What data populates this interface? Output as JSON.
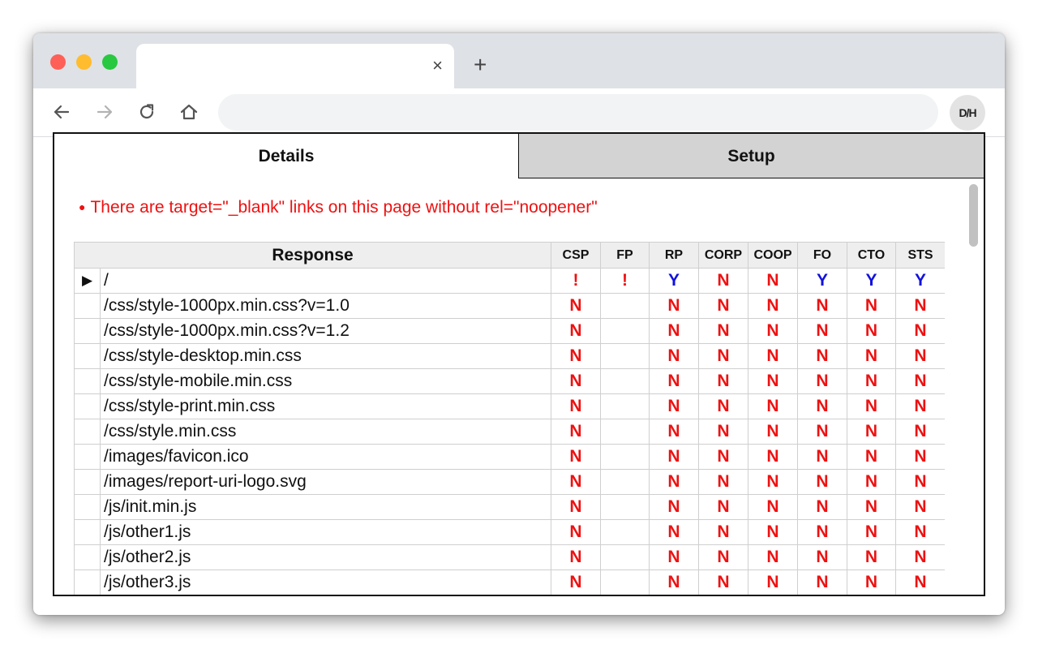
{
  "browser": {
    "tab_title": "",
    "tab_close": "×",
    "new_tab": "+",
    "address_value": "",
    "extension_label": "D/H"
  },
  "popup": {
    "tabs": [
      {
        "label": "Details",
        "active": true
      },
      {
        "label": "Setup",
        "active": false
      }
    ],
    "warning": "There are target=\"_blank\" links on this page without rel=\"noopener\"",
    "table": {
      "headers": [
        "Response",
        "CSP",
        "FP",
        "RP",
        "CORP",
        "COOP",
        "FO",
        "CTO",
        "STS"
      ],
      "rows": [
        {
          "marker": "▶",
          "url": "/",
          "values": [
            "!",
            "!",
            "Y",
            "N",
            "N",
            "Y",
            "Y",
            "Y"
          ]
        },
        {
          "marker": "",
          "url": "/css/style-1000px.min.css?v=1.0",
          "values": [
            "N",
            "",
            "N",
            "N",
            "N",
            "N",
            "N",
            "N"
          ]
        },
        {
          "marker": "",
          "url": "/css/style-1000px.min.css?v=1.2",
          "values": [
            "N",
            "",
            "N",
            "N",
            "N",
            "N",
            "N",
            "N"
          ]
        },
        {
          "marker": "",
          "url": "/css/style-desktop.min.css",
          "values": [
            "N",
            "",
            "N",
            "N",
            "N",
            "N",
            "N",
            "N"
          ]
        },
        {
          "marker": "",
          "url": "/css/style-mobile.min.css",
          "values": [
            "N",
            "",
            "N",
            "N",
            "N",
            "N",
            "N",
            "N"
          ]
        },
        {
          "marker": "",
          "url": "/css/style-print.min.css",
          "values": [
            "N",
            "",
            "N",
            "N",
            "N",
            "N",
            "N",
            "N"
          ]
        },
        {
          "marker": "",
          "url": "/css/style.min.css",
          "values": [
            "N",
            "",
            "N",
            "N",
            "N",
            "N",
            "N",
            "N"
          ]
        },
        {
          "marker": "",
          "url": "/images/favicon.ico",
          "values": [
            "N",
            "",
            "N",
            "N",
            "N",
            "N",
            "N",
            "N"
          ]
        },
        {
          "marker": "",
          "url": "/images/report-uri-logo.svg",
          "values": [
            "N",
            "",
            "N",
            "N",
            "N",
            "N",
            "N",
            "N"
          ]
        },
        {
          "marker": "",
          "url": "/js/init.min.js",
          "values": [
            "N",
            "",
            "N",
            "N",
            "N",
            "N",
            "N",
            "N"
          ]
        },
        {
          "marker": "",
          "url": "/js/other1.js",
          "values": [
            "N",
            "",
            "N",
            "N",
            "N",
            "N",
            "N",
            "N"
          ]
        },
        {
          "marker": "",
          "url": "/js/other2.js",
          "values": [
            "N",
            "",
            "N",
            "N",
            "N",
            "N",
            "N",
            "N"
          ]
        },
        {
          "marker": "",
          "url": "/js/other3.js",
          "values": [
            "N",
            "",
            "N",
            "N",
            "N",
            "N",
            "N",
            "N"
          ]
        }
      ]
    }
  },
  "colors": {
    "no": "#ee1111",
    "yes": "#1111dd",
    "warning": "#ee1111"
  }
}
